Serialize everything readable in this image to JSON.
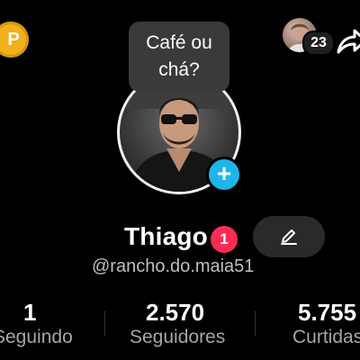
{
  "header": {
    "coin_letter": "P",
    "friends_count": "23"
  },
  "bubble": {
    "line1": "Café ou",
    "line2": "chá?"
  },
  "profile": {
    "name": "Thiago",
    "notification_count": "1",
    "username": "@rancho.do.maia51"
  },
  "stats": [
    {
      "value": "1",
      "label": "Seguindo"
    },
    {
      "value": "2.570",
      "label": "Seguidores"
    },
    {
      "value": "5.755",
      "label": "Curtidas"
    }
  ],
  "colors": {
    "background": "#000000",
    "coin": "#f0b21b",
    "add_button": "#20b5e8",
    "notification_badge": "#fe2c55",
    "edit_button": "#2a2a2a",
    "bubble": "#3a3a3a"
  },
  "icons": {
    "coin": "coin-icon",
    "share": "share-arrow-icon",
    "add": "plus-icon",
    "edit": "pencil-icon"
  }
}
